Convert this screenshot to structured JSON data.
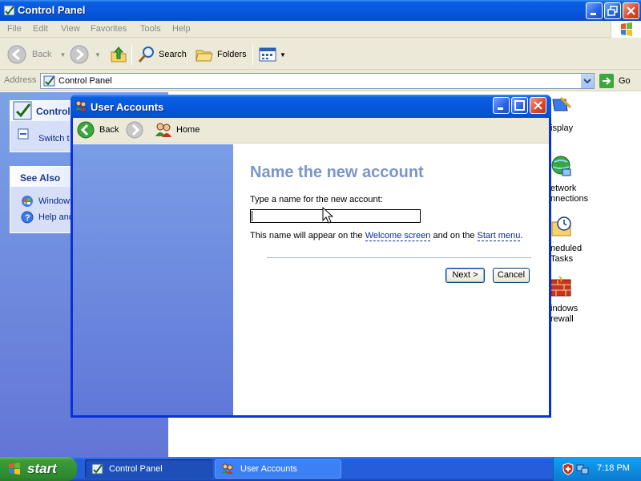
{
  "window": {
    "title": "Control Panel"
  },
  "menubar": {
    "items": [
      "File",
      "Edit",
      "View",
      "Favorites",
      "Tools",
      "Help"
    ]
  },
  "toolbar": {
    "back_label": "Back",
    "search_label": "Search",
    "folders_label": "Folders"
  },
  "address": {
    "label": "Address",
    "value": "Control Panel",
    "go_label": "Go"
  },
  "left_pane": {
    "control_panel_header": "Control",
    "switch_link": "Switch t",
    "see_also_header": "See Also",
    "see_also_items": [
      "Windows",
      "Help and"
    ]
  },
  "content_icons": [
    {
      "label_1": "isplay",
      "label_2": ""
    },
    {
      "label_1": "etwork",
      "label_2": "nnections"
    },
    {
      "label_1": "neduled",
      "label_2": "Tasks"
    },
    {
      "label_1": "indows",
      "label_2": "rewall"
    }
  ],
  "dialog": {
    "title": "User Accounts",
    "nav": {
      "back_label": "Back",
      "home_label": "Home"
    },
    "heading": "Name the new account",
    "prompt": "Type a name for the new account:",
    "input_value": "",
    "note_prefix": "This name will appear on the ",
    "note_link1": "Welcome screen",
    "note_middle": " and on the ",
    "note_link2": "Start menu",
    "note_suffix": ".",
    "next_label": "Next >",
    "cancel_label": "Cancel"
  },
  "taskbar": {
    "start_label": "start",
    "tasks": [
      "Control Panel",
      "User Accounts"
    ],
    "clock": "7:18 PM"
  },
  "colors": {
    "title_blue": "#0a5fe0",
    "dialog_heading": "#7a96c9",
    "link_blue": "#0c2a9a",
    "taskbar_blue": "#245edb",
    "start_green": "#3c9a3c"
  }
}
